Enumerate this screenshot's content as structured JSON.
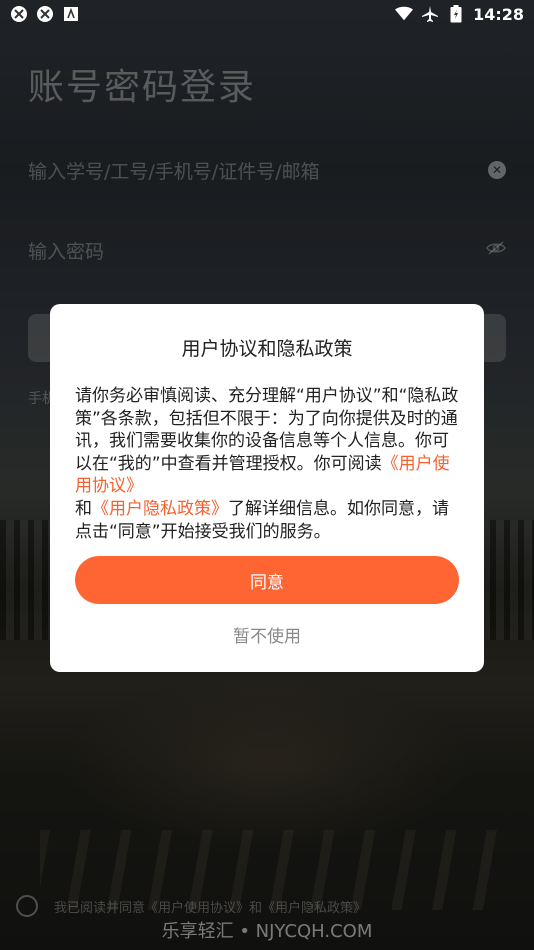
{
  "status_bar": {
    "time": "14:28",
    "left_icons": [
      "app-icon-1",
      "app-icon-2",
      "app-icon-3"
    ],
    "right_icons": [
      "wifi-icon",
      "airplane-icon",
      "battery-icon"
    ]
  },
  "login": {
    "title": "账号密码登录",
    "account_placeholder": "输入学号/工号/手机号/证件号/邮箱",
    "password_placeholder": "输入密码",
    "phone_hint": "手机",
    "agreement_text": "我已阅读并同意《用户使用协议》和《用户隐私政策》"
  },
  "dialog": {
    "title": "用户协议和隐私政策",
    "body_part1": "请你务必审慎阅读、充分理解“用户协议”和“隐私政策”各条款，包括但不限于：为了向你提供及时的通讯，我们需要收集你的设备信息等个人信息。你可以在“我的”中查看并管理授权。你可阅读",
    "link_user_agreement": "《用户使用协议》",
    "body_and": "和",
    "link_privacy_policy": "《用户隐私政策》",
    "body_part2": "了解详细信息。如你同意，请点击“同意”开始接受我们的服务。",
    "agree_label": "同意",
    "decline_label": "暂不使用"
  },
  "watermark": "乐享轻汇 • NJYCQH.COM",
  "colors": {
    "accent": "#ff6533",
    "link": "#f5612f"
  }
}
